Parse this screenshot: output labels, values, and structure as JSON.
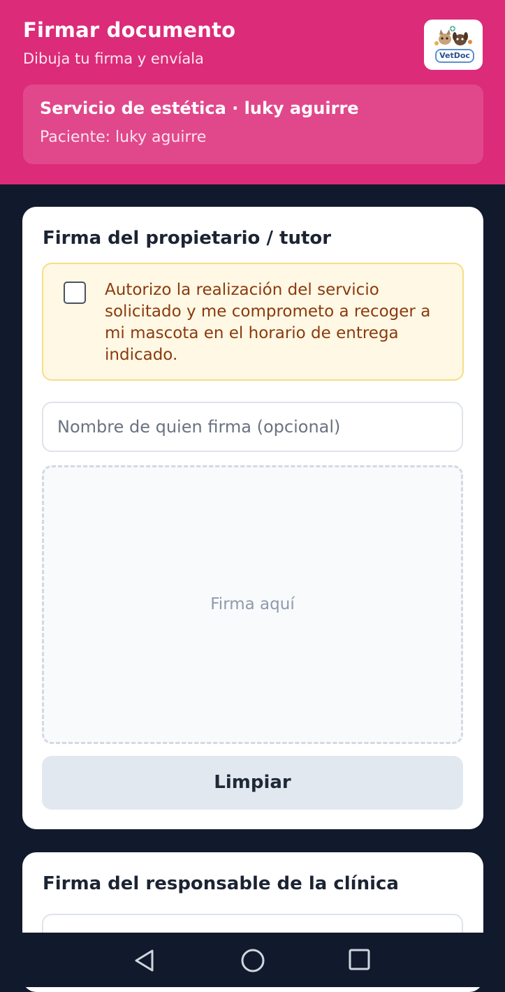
{
  "header": {
    "title": "Firmar documento",
    "subtitle": "Dibuja tu firma y envíala",
    "logo_text": "VetDoc",
    "background": "#dc2b78"
  },
  "info": {
    "service": "Servicio de estética · luky aguirre",
    "patient": "Paciente: luky aguirre"
  },
  "owner_section": {
    "title": "Firma del propietario / tutor",
    "consent_checked": false,
    "consent_text": "Autorizo la realización del servicio solicitado y me comprometo a recoger a mi mascota en el horario de entrega indicado.",
    "name_placeholder": "Nombre de quien firma (opcional)",
    "name_value": "",
    "signature_placeholder": "Firma aquí",
    "clear_label": "Limpiar"
  },
  "clinic_section": {
    "title": "Firma del responsable de la clínica"
  },
  "navbar": {
    "icons": [
      "back-icon",
      "home-icon",
      "recents-icon"
    ]
  }
}
